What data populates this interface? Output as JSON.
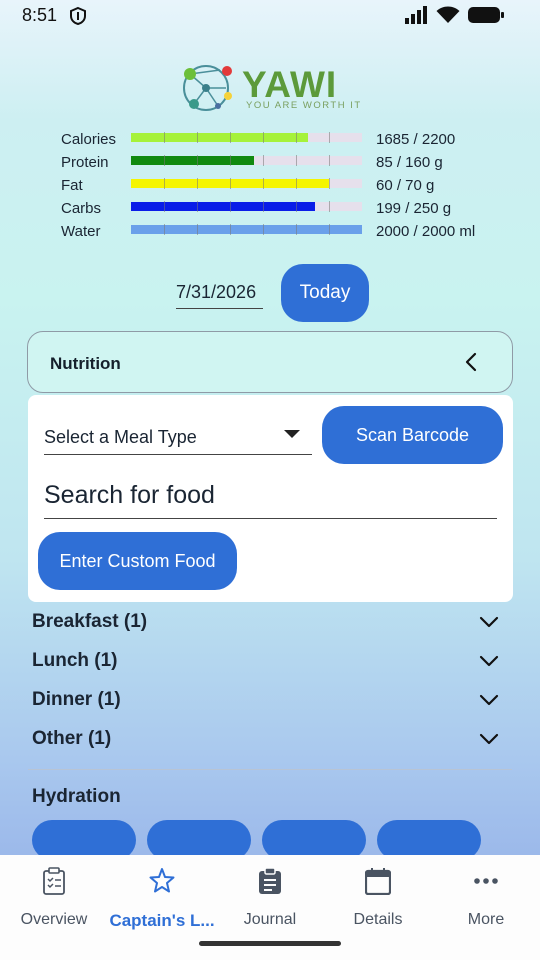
{
  "status": {
    "time": "8:51"
  },
  "logo": {
    "word": "YAWI",
    "tagline": "YOU ARE WORTH IT"
  },
  "nutrients": [
    {
      "label": "Calories",
      "value": "1685 / 2200",
      "progress": 0.766,
      "color": "#a6f23a"
    },
    {
      "label": "Protein",
      "value": "85 / 160 g",
      "progress": 0.531,
      "color": "#108a10"
    },
    {
      "label": "Fat",
      "value": "60 / 70 g",
      "progress": 0.857,
      "color": "#f5f500"
    },
    {
      "label": "Carbs",
      "value": "199 / 250 g",
      "progress": 0.796,
      "color": "#0a1de8"
    },
    {
      "label": "Water",
      "value": "2000 / 2000 ml",
      "progress": 1.0,
      "color": "#6aa0ea"
    }
  ],
  "date": {
    "value": "7/31/2026",
    "today_label": "Today"
  },
  "nutrition": {
    "title": "Nutrition",
    "meal_type_placeholder": "Select a Meal Type",
    "scan_barcode_label": "Scan Barcode",
    "search_placeholder": "Search for food",
    "custom_food_label": "Enter Custom Food"
  },
  "meals": [
    {
      "label": "Breakfast (1)"
    },
    {
      "label": "Lunch (1)"
    },
    {
      "label": "Dinner (1)"
    },
    {
      "label": "Other (1)"
    }
  ],
  "hydration": {
    "title": "Hydration"
  },
  "bottom_nav": [
    {
      "label": "Overview",
      "icon": "clipboard-check-icon"
    },
    {
      "label": "Captain's L...",
      "icon": "star-icon",
      "active": true
    },
    {
      "label": "Journal",
      "icon": "journal-icon"
    },
    {
      "label": "Details",
      "icon": "calendar-icon"
    },
    {
      "label": "More",
      "icon": "more-dots-icon"
    }
  ],
  "colors": {
    "primary": "#2f6fd6",
    "active_nav": "#2f6fd6"
  }
}
